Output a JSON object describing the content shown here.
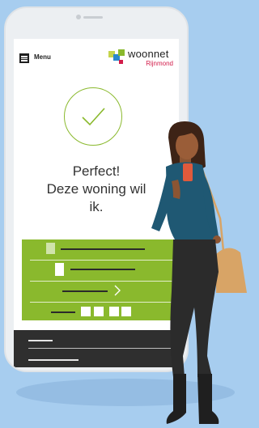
{
  "menu": {
    "label": "Menu"
  },
  "brand": {
    "name": "woonnet",
    "region": "Rijnmond",
    "colors": [
      "#8ab92d",
      "#2a88cc",
      "#c5d44b",
      "#d21b49"
    ]
  },
  "confirmation": {
    "lines": [
      "Perfect!",
      "Deze woning wil",
      "ik."
    ],
    "icon": "checkmark-circle-icon"
  },
  "colors": {
    "accent": "#8ab92d",
    "footer": "#2f2f2f",
    "background": "#a7cdef"
  }
}
